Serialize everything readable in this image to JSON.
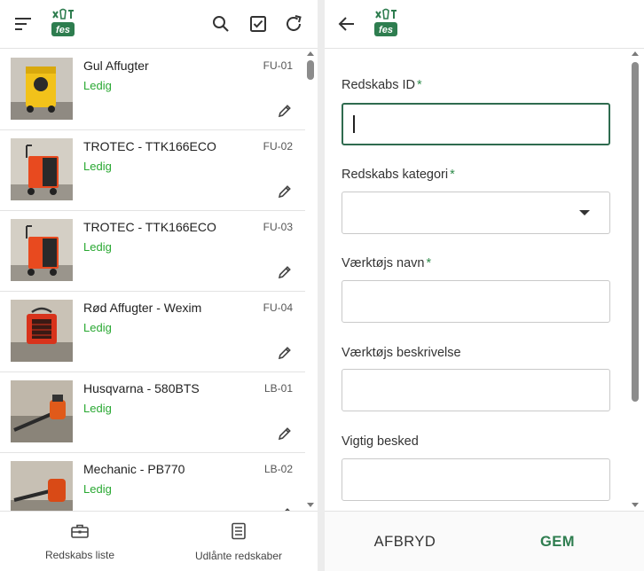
{
  "brand": {
    "logo_text": "fes",
    "accent": "#2e7d4f",
    "status_color": "#29a832"
  },
  "left_header": {
    "icons": [
      "sort-icon",
      "search-icon",
      "checkbox-icon",
      "refresh-icon"
    ]
  },
  "equipment_list": [
    {
      "name": "Gul Affugter",
      "status": "Ledig",
      "id": "FU-01",
      "image": "yellow-dehumidifier"
    },
    {
      "name": "TROTEC - TTK166ECO",
      "status": "Ledig",
      "id": "FU-02",
      "image": "red-dehumidifier"
    },
    {
      "name": "TROTEC - TTK166ECO",
      "status": "Ledig",
      "id": "FU-03",
      "image": "red-dehumidifier"
    },
    {
      "name": "Rød Affugter - Wexim",
      "status": "Ledig",
      "id": "FU-04",
      "image": "red-heater"
    },
    {
      "name": "Husqvarna - 580BTS",
      "status": "Ledig",
      "id": "LB-01",
      "image": "leaf-blower"
    },
    {
      "name": "Mechanic - PB770",
      "status": "Ledig",
      "id": "LB-02",
      "image": "leaf-blower"
    }
  ],
  "bottom_nav": [
    {
      "label": "Redskabs liste",
      "icon": "toolbox-icon"
    },
    {
      "label": "Udlånte redskaber",
      "icon": "list-document-icon"
    }
  ],
  "form": {
    "fields": [
      {
        "label": "Redskabs ID",
        "required": "*",
        "value": "",
        "type": "text"
      },
      {
        "label": "Redskabs kategori",
        "required": "*",
        "value": "",
        "type": "select"
      },
      {
        "label": "Værktøjs navn",
        "required": "*",
        "value": "",
        "type": "text"
      },
      {
        "label": "Værktøjs beskrivelse",
        "required": "",
        "value": "",
        "type": "text"
      },
      {
        "label": "Vigtig besked",
        "required": "",
        "value": "",
        "type": "text"
      }
    ]
  },
  "actions": {
    "cancel_label": "AFBRYD",
    "save_label": "GEM"
  }
}
